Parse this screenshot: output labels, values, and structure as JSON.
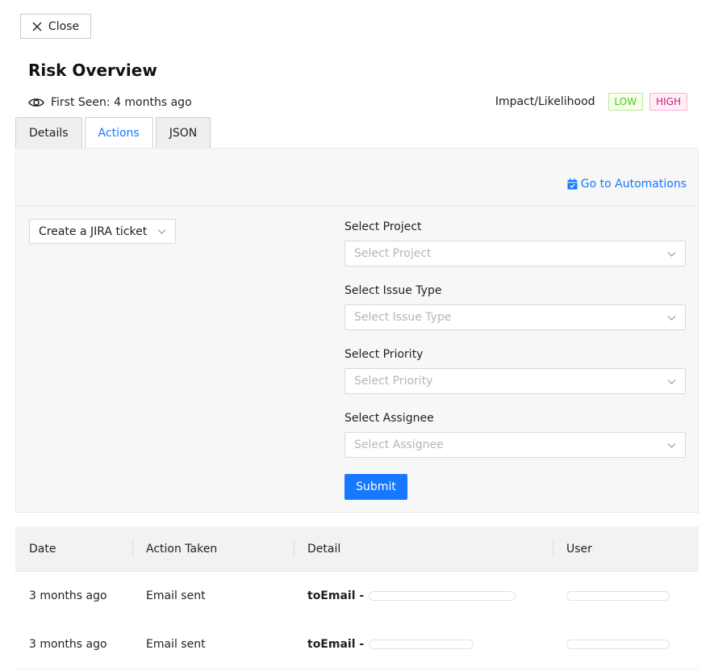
{
  "close_label": "Close",
  "page_title": "Risk Overview",
  "first_seen": "First Seen: 4 months ago",
  "impact": {
    "label": "Impact/Likelihood",
    "low": "LOW",
    "high": "HIGH"
  },
  "tabs": [
    {
      "label": "Details",
      "active": false
    },
    {
      "label": "Actions",
      "active": true
    },
    {
      "label": "JSON",
      "active": false
    }
  ],
  "goto_automations": "Go to Automations",
  "action_select": {
    "value": "Create a JIRA ticket"
  },
  "form": {
    "project": {
      "label": "Select Project",
      "placeholder": "Select Project"
    },
    "issue_type": {
      "label": "Select Issue Type",
      "placeholder": "Select Issue Type"
    },
    "priority": {
      "label": "Select Priority",
      "placeholder": "Select Priority"
    },
    "assignee": {
      "label": "Select Assignee",
      "placeholder": "Select Assignee"
    },
    "submit": "Submit"
  },
  "table": {
    "headers": [
      "Date",
      "Action Taken",
      "Detail",
      "User"
    ],
    "rows": [
      {
        "date": "3 months ago",
        "action": "Email sent",
        "detail_key": "toEmail -"
      },
      {
        "date": "3 months ago",
        "action": "Email sent",
        "detail_key": "toEmail -"
      }
    ]
  },
  "colors": {
    "primary": "#1677ff",
    "low": "#52c41a",
    "high": "#c41d7f"
  }
}
